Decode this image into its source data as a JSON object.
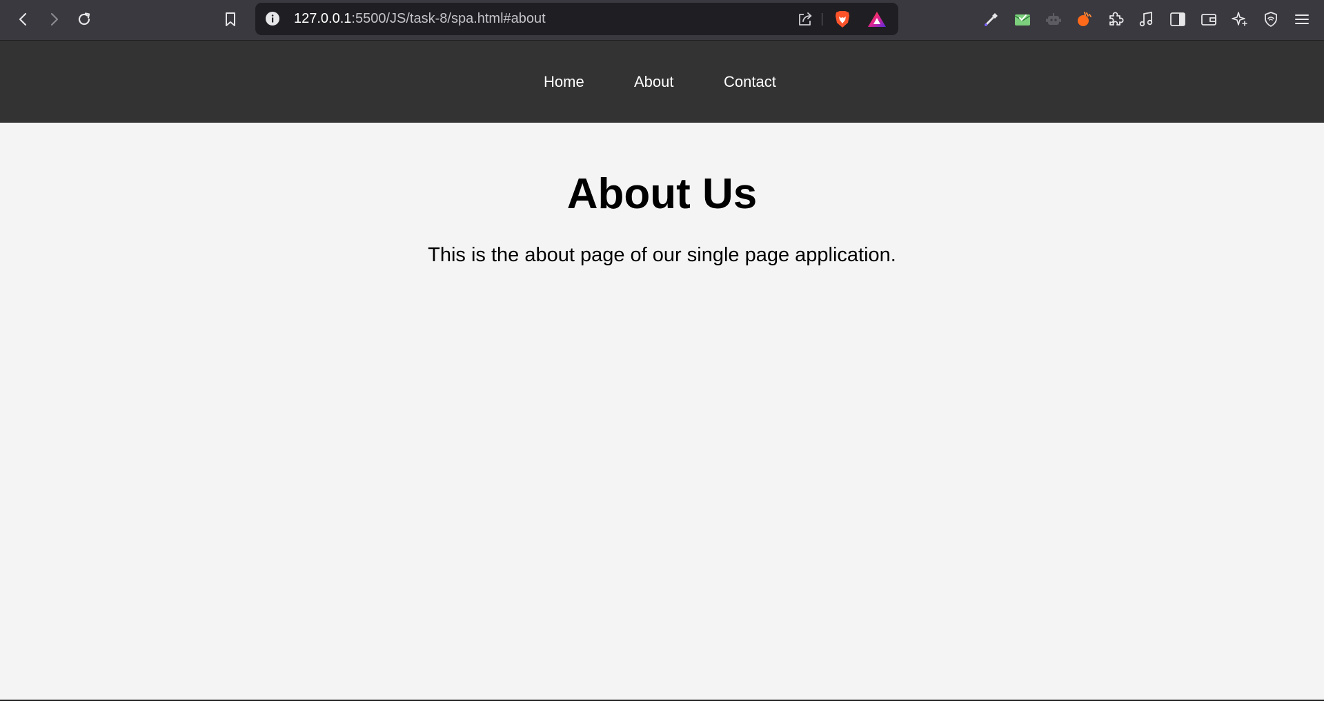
{
  "browser": {
    "url_host": "127.0.0.1",
    "url_path": ":5500/JS/task-8/spa.html#about",
    "icons": {
      "back": "back-arrow-icon",
      "forward": "forward-arrow-icon",
      "reload": "reload-icon",
      "bookmark": "bookmark-icon",
      "site_info": "info-icon",
      "share": "share-icon",
      "brave_shields": "brave-lion-icon",
      "brave_rewards": "rewards-triangle-icon",
      "extensions": [
        "color-picker-icon",
        "mail-check-icon",
        "robot-icon",
        "orange-extension-icon",
        "puzzle-icon",
        "music-icon",
        "sidebar-icon",
        "wallet-icon",
        "leo-sparkle-icon",
        "vpn-shield-icon",
        "menu-icon"
      ]
    },
    "colors": {
      "toolbar": "#3a393f",
      "url_bar": "#1f1f23",
      "brave_orange": "#fb542b"
    }
  },
  "nav": {
    "items": [
      {
        "label": "Home"
      },
      {
        "label": "About"
      },
      {
        "label": "Contact"
      }
    ],
    "background": "#333333"
  },
  "main": {
    "title": "About Us",
    "text": "This is the about page of our single page application."
  }
}
